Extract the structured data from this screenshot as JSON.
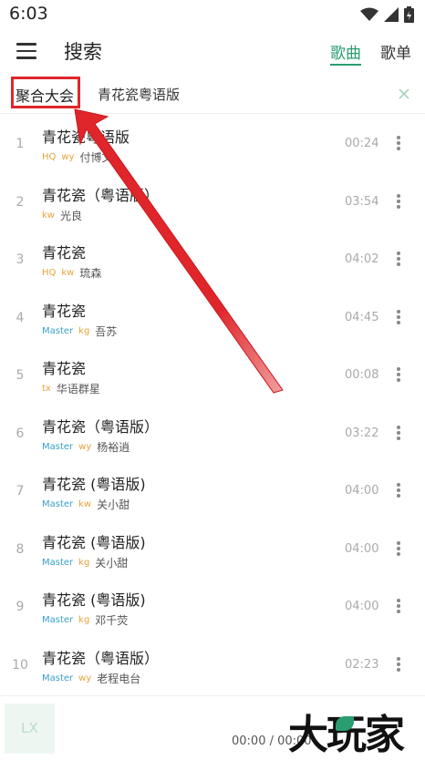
{
  "status": {
    "time": "6:03"
  },
  "header": {
    "title": "搜索",
    "tab_songs": "歌曲",
    "tab_playlists": "歌单"
  },
  "search": {
    "source": "聚合大会",
    "query": "青花瓷粤语版"
  },
  "songs": [
    {
      "num": "1",
      "title": "青花瓷粤语版",
      "tags": [
        "HQ",
        "wy"
      ],
      "artist": "付博文",
      "duration": "00:24"
    },
    {
      "num": "2",
      "title": "青花瓷（粤语版）",
      "tags": [
        "kw"
      ],
      "artist": "光良",
      "duration": "03:54"
    },
    {
      "num": "3",
      "title": "青花瓷",
      "tags": [
        "HQ",
        "kw"
      ],
      "artist": "琉森",
      "duration": "04:02"
    },
    {
      "num": "4",
      "title": "青花瓷",
      "tags": [
        "Master",
        "kg"
      ],
      "artist": "吾苏",
      "duration": "04:45"
    },
    {
      "num": "5",
      "title": "青花瓷",
      "tags": [
        "tx"
      ],
      "artist": "华语群星",
      "duration": "00:08"
    },
    {
      "num": "6",
      "title": "青花瓷（粤语版）",
      "tags": [
        "Master",
        "wy"
      ],
      "artist": "杨裕逍",
      "duration": "03:22"
    },
    {
      "num": "7",
      "title": "青花瓷 (粤语版)",
      "tags": [
        "Master",
        "kw"
      ],
      "artist": "关小甜",
      "duration": "04:00"
    },
    {
      "num": "8",
      "title": "青花瓷 (粤语版)",
      "tags": [
        "Master",
        "kg"
      ],
      "artist": "关小甜",
      "duration": "04:00"
    },
    {
      "num": "9",
      "title": "青花瓷 (粤语版)",
      "tags": [
        "Master",
        "kg"
      ],
      "artist": "邓千荧",
      "duration": "04:00"
    },
    {
      "num": "10",
      "title": "青花瓷（粤语版）",
      "tags": [
        "Master",
        "wy"
      ],
      "artist": "老程电台",
      "duration": "02:23"
    }
  ],
  "player": {
    "cover_text": "LX",
    "time": "00:00 / 00:00"
  },
  "watermark": {
    "text": "大玩家"
  },
  "colors": {
    "accent": "#2a9d6f",
    "annotation": "#e0262b"
  }
}
